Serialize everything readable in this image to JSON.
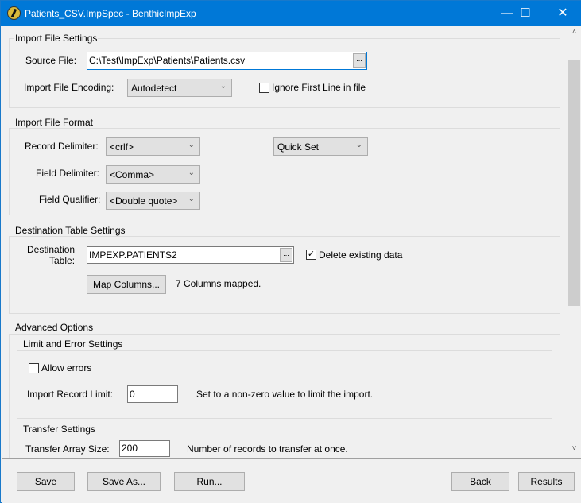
{
  "window": {
    "title": "Patients_CSV.ImpSpec - BenthicImpExp",
    "minimize": "—",
    "maximize": "☐",
    "close": "✕"
  },
  "import_file_settings": {
    "legend": "Import File Settings",
    "source_label": "Source File:",
    "source_value": "C:\\Test\\ImpExp\\Patients\\Patients.csv",
    "browse": "...",
    "encoding_label": "Import File Encoding:",
    "encoding_value": "Autodetect",
    "ignore_first_line_label": "Ignore First Line in file",
    "ignore_first_line_checked": false
  },
  "import_file_format": {
    "legend": "Import File Format",
    "record_delim_label": "Record Delimiter:",
    "record_delim_value": "<crlf>",
    "quick_set": "Quick Set",
    "field_delim_label": "Field Delimiter:",
    "field_delim_value": "<Comma>",
    "qualifier_label": "Field Qualifier:",
    "qualifier_value": "<Double quote>"
  },
  "destination": {
    "legend": "Destination Table Settings",
    "label_line1": "Destination",
    "label_line2": "Table:",
    "value": "IMPEXP.PATIENTS2",
    "browse": "...",
    "delete_label": "Delete existing data",
    "delete_checked": true,
    "map_button": "Map Columns...",
    "mapped_text": "7 Columns mapped."
  },
  "advanced": {
    "legend": "Advanced Options",
    "limits": {
      "legend": "Limit and Error Settings",
      "allow_errors_label": "Allow errors",
      "allow_errors_checked": false,
      "record_limit_label": "Import Record Limit:",
      "record_limit_value": "0",
      "record_limit_hint": "Set to a non-zero value to limit the import."
    },
    "transfer": {
      "legend": "Transfer Settings",
      "array_size_label": "Transfer Array Size:",
      "array_size_value": "200",
      "array_size_hint": "Number of records to transfer at once."
    }
  },
  "scrollbar": {
    "up": "˄",
    "down": "˅"
  },
  "buttons": {
    "save": "Save",
    "save_as": "Save As...",
    "run": "Run...",
    "back": "Back",
    "results": "Results"
  }
}
